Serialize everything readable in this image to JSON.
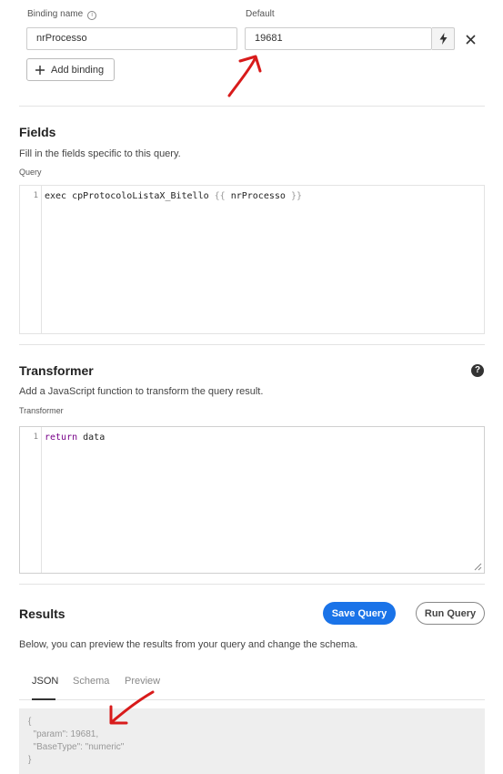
{
  "binding": {
    "name_label": "Binding name",
    "default_label": "Default",
    "name_value": "nrProcesso",
    "default_value": "19681",
    "add_binding_label": "Add binding"
  },
  "fields": {
    "title": "Fields",
    "description": "Fill in the fields specific to this query.",
    "query_label": "Query",
    "line_number": "1",
    "code": {
      "prefix": "exec cpProtocoloListaX_Bitello ",
      "open_brace": "{{",
      "variable": " nrProcesso ",
      "close_brace": "}}"
    }
  },
  "transformer": {
    "title": "Transformer",
    "description": "Add a JavaScript function to transform the query result.",
    "label": "Transformer",
    "line_number": "1",
    "code": {
      "keyword": "return",
      "rest": " data"
    }
  },
  "results": {
    "title": "Results",
    "save_label": "Save Query",
    "run_label": "Run Query",
    "description": "Below, you can preview the results from your query and change the schema.",
    "tabs": [
      {
        "label": "JSON",
        "active": true
      },
      {
        "label": "Schema",
        "active": false
      },
      {
        "label": "Preview",
        "active": false
      }
    ],
    "json_lines": [
      "{",
      "  \"param\": 19681,",
      "  \"BaseType\": \"numeric\"",
      "}"
    ]
  },
  "colors": {
    "primary": "#1a73e8",
    "annotation_arrow": "#d81b1b"
  },
  "icons": {
    "info": "info-icon",
    "bolt": "bolt-icon",
    "close": "close-icon",
    "plus": "plus-icon",
    "help": "help-icon",
    "resize": "resize-handle-icon"
  }
}
